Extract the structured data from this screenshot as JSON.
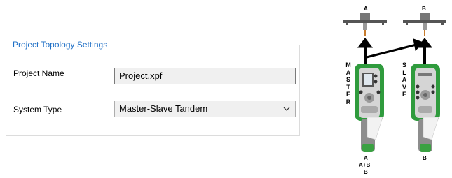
{
  "group": {
    "title": "Project Topology Settings"
  },
  "fields": {
    "project_name": {
      "label": "Project Name",
      "value": "Project.xpf"
    },
    "system_type": {
      "label": "System Type",
      "value": "Master-Slave Tandem"
    }
  },
  "figure": {
    "top_label_a": "A",
    "top_label_b": "B",
    "master_letters": [
      "M",
      "A",
      "S",
      "T",
      "E",
      "R"
    ],
    "slave_letters": [
      "S",
      "L",
      "A",
      "V",
      "E"
    ],
    "master_bottom": [
      "A",
      "A+B",
      "B"
    ],
    "slave_bottom": "B",
    "icons": [
      "arm-tool-icon",
      "handheld-controller-icon",
      "arrow-icon"
    ],
    "colors": {
      "accent_green": "#3aa142",
      "legend_blue": "#1e6fc6"
    }
  }
}
